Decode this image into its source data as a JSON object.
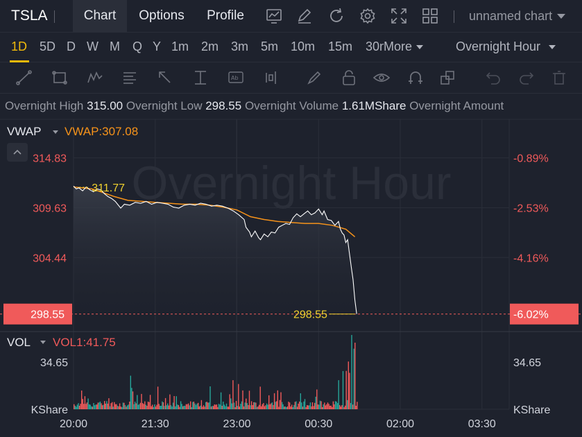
{
  "header": {
    "symbol": "TSLA",
    "tabs": [
      {
        "label": "Chart",
        "active": true
      },
      {
        "label": "Options",
        "active": false
      },
      {
        "label": "Profile",
        "active": false
      }
    ],
    "icons": [
      "chart-type-icon",
      "draw-edit-icon",
      "refresh-icon",
      "settings-gear-icon",
      "fullscreen-icon",
      "layout-grid-icon"
    ],
    "chart_name": "unnamed chart"
  },
  "intervals": {
    "items": [
      "1D",
      "5D",
      "D",
      "W",
      "M",
      "Q",
      "Y",
      "1m",
      "2m",
      "3m",
      "5m",
      "10m",
      "15m",
      "30m"
    ],
    "active": "1D",
    "more_label": "More",
    "session": "Overnight Hour"
  },
  "drawing_tools": [
    "trend-line-icon",
    "rectangle-icon",
    "pattern-icon",
    "fib-icon",
    "arrow-icon",
    "measure-icon",
    "text-note-icon",
    "long-position-icon",
    "brush-icon",
    "lock-icon",
    "eye-icon",
    "magnet-icon",
    "layers-icon",
    "undo-icon",
    "delete-icon"
  ],
  "info": {
    "high_label": "Overnight High",
    "high_value": "315.00",
    "low_label": "Overnight Low",
    "low_value": "298.55",
    "volume_label": "Overnight Volume",
    "volume_value": "1.61MShare",
    "amount_label": "Overnight Amount"
  },
  "indicators": {
    "main_name": "VWAP",
    "main_value": "VWAP:307.08",
    "sub_name": "VOL",
    "sub_value": "VOL1:41.75"
  },
  "colors": {
    "up": "#26a69a",
    "down": "#f05a5a",
    "vwap": "#f7931a",
    "price_line": "#ffffff",
    "highlight": "#f0d12e"
  },
  "chart_data": {
    "type": "line",
    "watermark": "Overnight Hour",
    "price_axis": {
      "ticks": [
        314.83,
        309.63,
        304.44
      ],
      "tick_labels": [
        "314.83",
        "309.63",
        "304.44"
      ],
      "pct_labels": [
        "-0.89%",
        "-2.53%",
        "-4.16%"
      ],
      "current_price": "298.55",
      "current_pct": "-6.02%",
      "ylim": [
        297.3,
        319.0
      ]
    },
    "high_marker": {
      "label": "311.77",
      "value": 311.77
    },
    "last_marker": {
      "label": "298.55",
      "value": 298.55
    },
    "time_axis": {
      "labels": [
        "20:00",
        "21:30",
        "23:00",
        "00:30",
        "02:00",
        "03:30"
      ],
      "positions_min": [
        0,
        90,
        180,
        270,
        360,
        450
      ],
      "xlim_min": [
        0,
        480
      ]
    },
    "series": [
      {
        "name": "VWAP",
        "x": [
          0,
          10,
          20,
          30,
          45,
          60,
          75,
          90,
          105,
          120,
          135,
          150,
          165,
          180,
          195,
          210,
          225,
          240,
          255,
          270,
          285,
          300,
          310
        ],
        "y": [
          311.8,
          311.7,
          311.6,
          311.3,
          310.8,
          310.4,
          310.3,
          310.2,
          310.1,
          310.0,
          310.0,
          309.9,
          309.7,
          309.4,
          308.7,
          308.4,
          308.2,
          308.1,
          308.0,
          308.0,
          307.8,
          307.4,
          306.6
        ]
      },
      {
        "name": "Price",
        "x": [
          0,
          3,
          6,
          10,
          14,
          18,
          22,
          26,
          30,
          34,
          38,
          42,
          46,
          52,
          56,
          62,
          68,
          74,
          80,
          86,
          92,
          98,
          104,
          110,
          116,
          122,
          128,
          134,
          140,
          146,
          152,
          158,
          164,
          170,
          176,
          182,
          188,
          190,
          194,
          196,
          200,
          204,
          206,
          210,
          214,
          218,
          222,
          226,
          230,
          234,
          238,
          242,
          246,
          250,
          254,
          258,
          262,
          266,
          270,
          274,
          276,
          280,
          284,
          288,
          292,
          294,
          296,
          298,
          300,
          302,
          304,
          306,
          308,
          310,
          312
        ],
        "y": [
          311.9,
          311.6,
          311.7,
          311.4,
          311.8,
          311.5,
          311.3,
          311.6,
          311.5,
          311.1,
          310.8,
          310.6,
          310.3,
          309.6,
          310.0,
          309.9,
          310.2,
          310.1,
          310.3,
          310.0,
          310.2,
          310.1,
          310.0,
          309.7,
          309.6,
          309.9,
          310.0,
          309.9,
          310.1,
          310.0,
          309.8,
          309.9,
          309.8,
          309.6,
          309.3,
          308.9,
          308.4,
          307.6,
          307.1,
          306.6,
          307.2,
          306.5,
          306.3,
          306.9,
          306.6,
          307.1,
          307.0,
          307.6,
          307.8,
          308.0,
          307.9,
          308.6,
          309.0,
          308.7,
          309.0,
          309.3,
          308.9,
          309.1,
          309.5,
          308.9,
          309.3,
          308.4,
          308.3,
          307.8,
          308.2,
          307.4,
          307.0,
          306.8,
          306.0,
          306.3,
          304.9,
          303.5,
          302.1,
          300.0,
          298.55
        ]
      }
    ],
    "volume": {
      "label_value": "34.65",
      "unit": "KShare",
      "ylim": [
        0,
        55
      ],
      "tick": 34.65
    }
  }
}
